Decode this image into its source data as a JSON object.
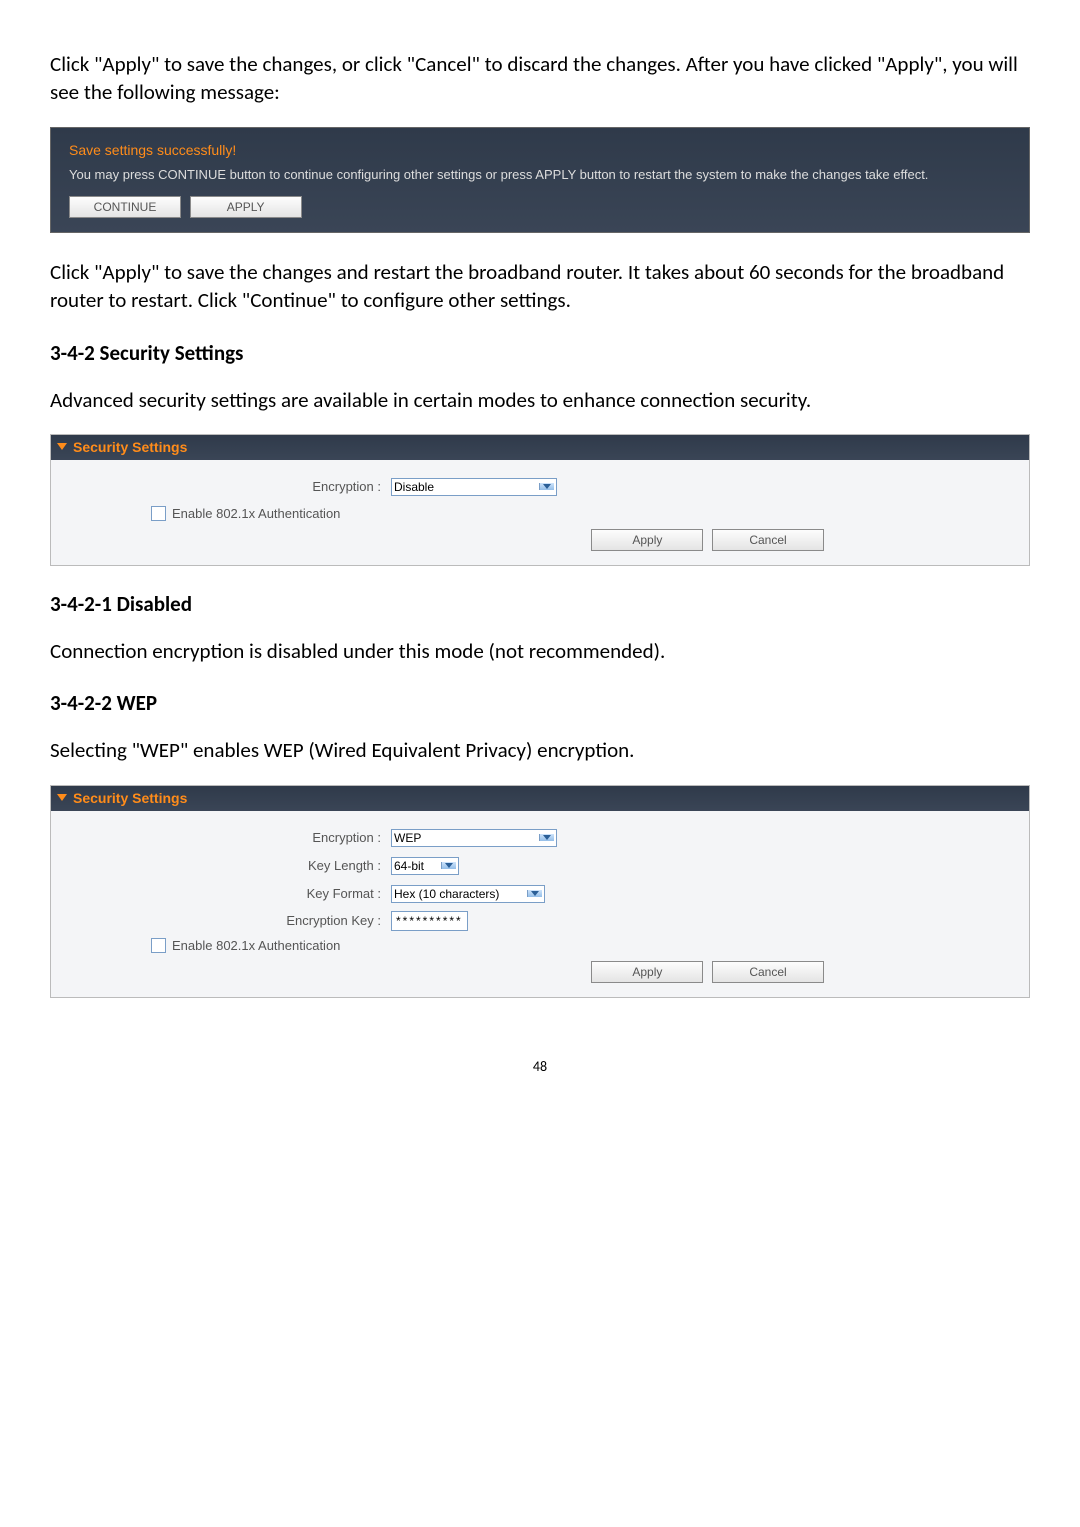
{
  "doc": {
    "intro1": "Click \"Apply\" to save the changes, or click \"Cancel\" to discard the changes. After you have clicked \"Apply\", you will see the following message:",
    "save_panel": {
      "title": "Save settings successfully!",
      "desc": "You may press CONTINUE button to continue configuring other settings or press APPLY button to restart the system to make the changes take effect.",
      "continue_label": "CONTINUE",
      "apply_label": "APPLY"
    },
    "intro2": "Click \"Apply\" to save the changes and restart the broadband router. It takes about 60 seconds for the broadband router to restart. Click \"Continue\" to configure other settings.",
    "h342": "3-4-2 Security Settings",
    "p342": "Advanced security settings are available in certain modes to enhance connection security.",
    "security1": {
      "header": "Security Settings",
      "encryption_label": "Encryption :",
      "encryption_value": "Disable",
      "auth_label": "Enable 802.1x Authentication",
      "apply": "Apply",
      "cancel": "Cancel"
    },
    "h3421": "3-4-2-1 Disabled",
    "p3421": "Connection encryption is disabled under this mode (not recommended).",
    "h3422": "3-4-2-2 WEP",
    "p3422": "Selecting \"WEP\" enables WEP (Wired Equivalent Privacy) encryption.",
    "security2": {
      "header": "Security Settings",
      "encryption_label": "Encryption :",
      "encryption_value": "WEP",
      "keylen_label": "Key Length :",
      "keylen_value": "64-bit",
      "keyfmt_label": "Key Format :",
      "keyfmt_value": "Hex (10  characters)",
      "enckey_label": "Encryption Key :",
      "enckey_value": "**********",
      "auth_label": "Enable 802.1x Authentication",
      "apply": "Apply",
      "cancel": "Cancel"
    },
    "page_number": "48"
  }
}
